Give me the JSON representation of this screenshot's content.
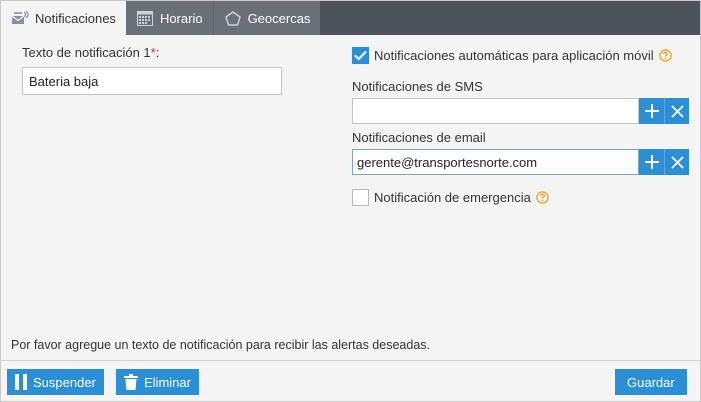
{
  "tabs": [
    {
      "label": "Notificaciones",
      "icon": "envelope-signal-icon",
      "active": true
    },
    {
      "label": "Horario",
      "icon": "calendar-icon",
      "active": false
    },
    {
      "label": "Geocercas",
      "icon": "pentagon-icon",
      "active": false
    }
  ],
  "left": {
    "label": "Texto de notificación 1",
    "required_mark": "*",
    "label_suffix": ":",
    "value": "Bateria baja"
  },
  "right": {
    "auto_notifications": {
      "label": "Notificaciones automáticas para aplicación móvil",
      "checked": true
    },
    "sms": {
      "label": "Notificaciones de SMS",
      "value": ""
    },
    "email": {
      "label": "Notificaciones de email",
      "value": "gerente@transportesnorte.com"
    },
    "emergency": {
      "label": "Notificación de emergencia",
      "checked": false
    }
  },
  "hint": "Por favor agregue un texto de notificación para recibir las alertas deseadas.",
  "footer": {
    "suspend_label": "Suspender",
    "delete_label": "Eliminar",
    "save_label": "Guardar"
  },
  "colors": {
    "accent": "#2a8fd6",
    "tabbar": "#4d535a",
    "help": "#e8a21a",
    "required": "#d9231f"
  }
}
